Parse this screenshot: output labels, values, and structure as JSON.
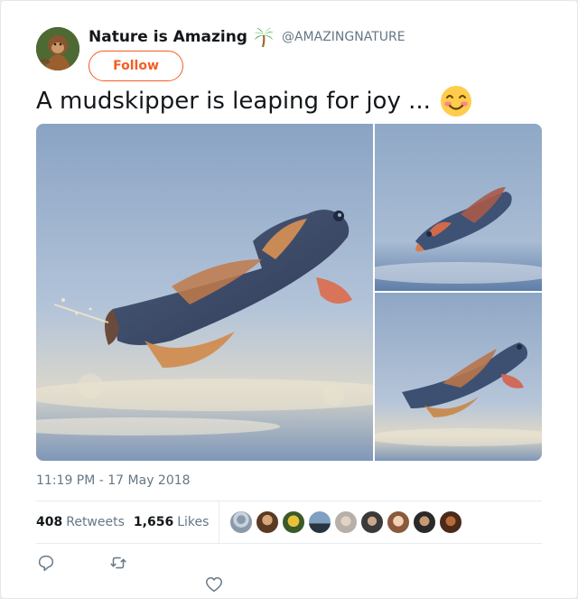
{
  "author": {
    "display_name": "Nature is Amazing",
    "name_emoji": "palm-tree-icon",
    "handle": "@AMAZINGNATURE"
  },
  "follow_label": "Follow",
  "tweet": {
    "text": "A mudskipper is leaping for joy ...",
    "trailing_emoji": "smiling-face-icon"
  },
  "timestamp": "11:19 PM - 17 May 2018",
  "stats": {
    "retweets_count": "408",
    "retweets_label": "Retweets",
    "likes_count": "1,656",
    "likes_label": "Likes"
  },
  "likers_count_shown": 9,
  "colors": {
    "follow_accent": "#f45d22",
    "secondary_text": "#657786",
    "primary_text": "#14171a",
    "divider": "#e6ecf0"
  },
  "actions": [
    "reply-icon",
    "retweet-icon",
    "like-icon"
  ]
}
